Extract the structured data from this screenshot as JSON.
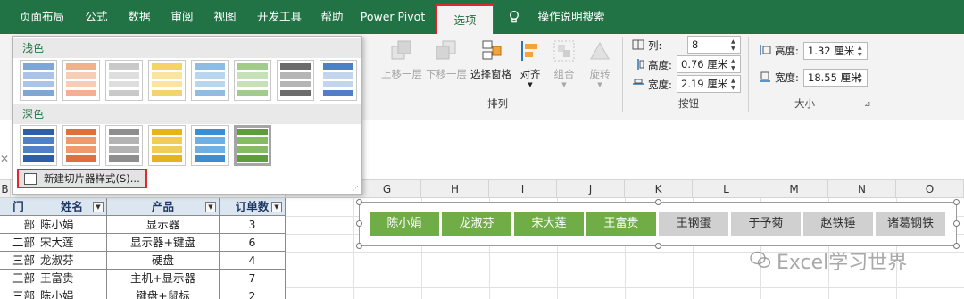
{
  "ribbon_tabs": [
    "页面布局",
    "公式",
    "数据",
    "审阅",
    "视图",
    "开发工具",
    "帮助",
    "Power Pivot",
    "选项",
    "操作说明搜索"
  ],
  "gallery": {
    "light_label": "浅色",
    "dark_label": "深色",
    "new_style_label": "新建切片器样式(S)..."
  },
  "arrange": {
    "bring_forward": "上移一层",
    "send_backward": "下移一层",
    "selection_pane": "选择窗格",
    "align": "对齐",
    "group": "组合",
    "rotate": "旋转",
    "group_label": "排列"
  },
  "buttons_group": {
    "columns_label": "列:",
    "columns_value": "8",
    "height_label": "高度:",
    "height_value": "0.76 厘米",
    "width_label": "宽度:",
    "width_value": "2.19 厘米",
    "group_label": "按钮"
  },
  "size_group": {
    "height_label": "高度:",
    "height_value": "1.32 厘米",
    "width_label": "宽度:",
    "width_value": "18.55 厘米",
    "group_label": "大小"
  },
  "columns_visible": [
    "B",
    "G",
    "H",
    "I",
    "J",
    "K",
    "L",
    "M",
    "N",
    "O"
  ],
  "table": {
    "headers": [
      "门",
      "姓名",
      "产品",
      "订单数"
    ],
    "rows": [
      [
        "部",
        "陈小娟",
        "显示器",
        "3"
      ],
      [
        "二部",
        "宋大莲",
        "显示器+键盘",
        "6"
      ],
      [
        "三部",
        "龙淑芬",
        "硬盘",
        "4"
      ],
      [
        "三部",
        "王富贵",
        "主机+显示器",
        "7"
      ],
      [
        "三部",
        "陈小娟",
        "键盘+鼠标",
        "2"
      ]
    ]
  },
  "slicer_items": [
    {
      "label": "陈小娟",
      "selected": true
    },
    {
      "label": "龙淑芬",
      "selected": true
    },
    {
      "label": "宋大莲",
      "selected": true
    },
    {
      "label": "王富贵",
      "selected": true
    },
    {
      "label": "王钢蛋",
      "selected": false
    },
    {
      "label": "于予菊",
      "selected": false
    },
    {
      "label": "赵铁锤",
      "selected": false
    },
    {
      "label": "诸葛钢铁",
      "selected": false
    }
  ],
  "watermark": "Excel学习世界",
  "colors": {
    "brand": "#217346",
    "highlight": "#e0282e",
    "slicer_on": "#70ad47",
    "slicer_off": "#d0d0d0"
  }
}
